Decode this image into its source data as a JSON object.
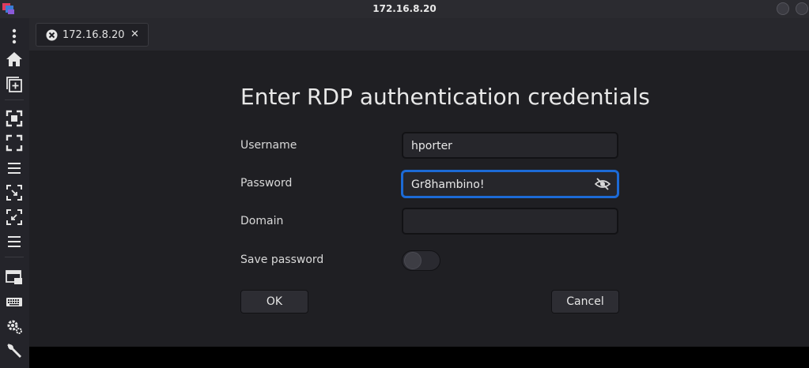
{
  "window": {
    "title": "172.16.8.20"
  },
  "tab": {
    "label": "172.16.8.20"
  },
  "dialog": {
    "title": "Enter RDP authentication credentials",
    "username_label": "Username",
    "username_value": "hporter",
    "password_label": "Password",
    "password_value": "Gr8hambino!",
    "domain_label": "Domain",
    "domain_value": "",
    "save_password_label": "Save password",
    "save_password_on": false,
    "ok_label": "OK",
    "cancel_label": "Cancel"
  },
  "sidebar": {
    "icons": [
      "menu-icon",
      "home-icon",
      "new-window-icon",
      "fit-window-icon",
      "fullscreen-icon",
      "list-icon",
      "scale-icon",
      "dynamic-resolution-icon",
      "list-icon",
      "multi-monitor-icon",
      "keyboard-icon",
      "settings-icon",
      "tools-icon"
    ]
  },
  "colors": {
    "accent": "#1c6ad6",
    "background": "#1f1f23"
  }
}
